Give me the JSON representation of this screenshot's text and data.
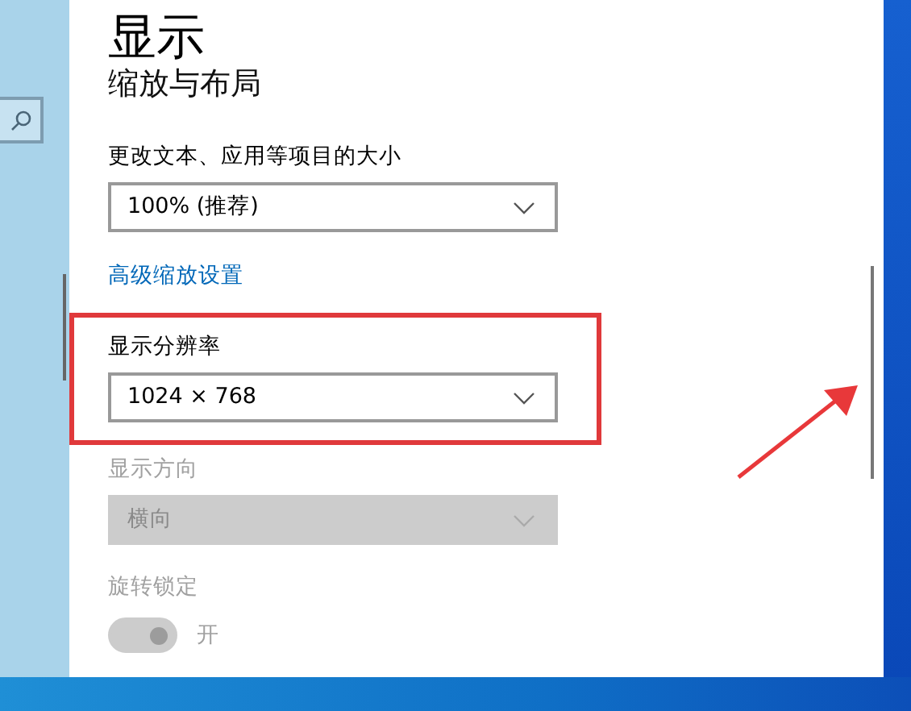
{
  "page_title": "显示",
  "section_heading": "缩放与布局",
  "settings": [
    {
      "kind": "dropdown",
      "label": "更改文本、应用等项目的大小",
      "value": "100% (推荐)",
      "disabled": false,
      "highlighted": false
    },
    {
      "kind": "link",
      "text": "高级缩放设置"
    },
    {
      "kind": "dropdown",
      "label": "显示分辨率",
      "value": "1024 × 768",
      "disabled": false,
      "highlighted": true
    },
    {
      "kind": "dropdown",
      "label": "显示方向",
      "value": "横向",
      "disabled": true,
      "highlighted": false
    },
    {
      "kind": "toggle",
      "label": "旋转锁定",
      "state_text": "开",
      "on": true,
      "disabled": true
    }
  ]
}
